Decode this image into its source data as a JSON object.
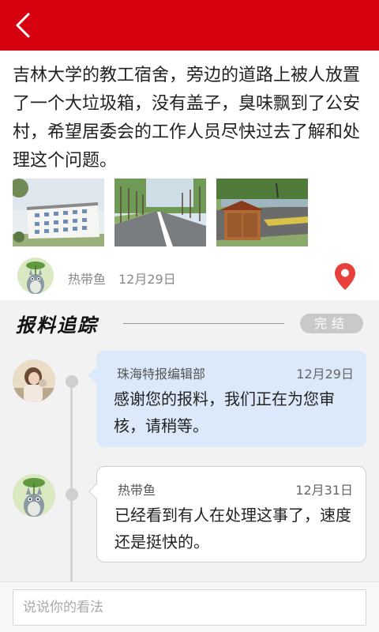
{
  "header": {
    "back_icon": "chevron-left-icon",
    "bar_color": "#d6000f"
  },
  "post": {
    "text": "吉林大学的教工宿舍，旁边的道路上被人放置了一个大垃圾箱，没有盖子，臭味飘到了公安村，希望居委会的工作人员尽快过去了解和处理这个问题。",
    "photos": [
      "building-photo",
      "tree-road-photo",
      "trash-bin-photo"
    ],
    "author": {
      "name": "热带鱼",
      "date": "12月29日"
    },
    "location_icon": "map-pin-icon"
  },
  "tracking": {
    "title": "报料追踪",
    "status": "完结",
    "entries": [
      {
        "name": "珠海特报编辑部",
        "date": "12月29日",
        "text": "感谢您的报料，我们正在为您审核，请稍等。"
      },
      {
        "name": "热带鱼",
        "date": "12月31日",
        "text": "已经看到有人在处理这事了，速度还是挺快的。"
      }
    ]
  },
  "comment": {
    "placeholder": "说说你的看法"
  }
}
